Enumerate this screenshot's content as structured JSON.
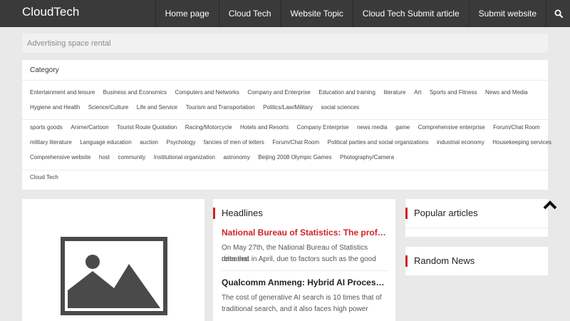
{
  "header": {
    "brand": "CloudTech",
    "nav": [
      "Home page",
      "Cloud Tech",
      "Website Topic",
      "Cloud Tech Submit article",
      "Submit website"
    ],
    "search_icon": "search-icon"
  },
  "ad": {
    "text": "Advertising space rental"
  },
  "category": {
    "title": "Category",
    "groups": [
      [
        "Entertainment and leisure",
        "Business and Economics",
        "Computers and Networks",
        "Company and Enterprise",
        "Education and training",
        "literature",
        "Art",
        "Sports and Fitness",
        "News and Media"
      ],
      [
        "Hygiene and Health",
        "Science/Culture",
        "Life and Service",
        "Tourism and Transportation",
        "Politics/Law/Military",
        "social sciences"
      ],
      [
        "sports goods",
        "Anime/Cartoon",
        "Tourist Route Quotation",
        "Racing/Motorcycle",
        "Hotels and Resorts",
        "Company Enterprise",
        "news media",
        "game",
        "Comprehensive enterprise",
        "Forum/Chat Room"
      ],
      [
        "military literature",
        "Language education",
        "auction",
        "Psychology",
        "fancies of men of letters",
        "Forum/Chat Room",
        "Political parties and social organizations",
        "industrial economy",
        "Housekeeping services"
      ],
      [
        "Comprehensive website",
        "host",
        "community",
        "Institutional organization",
        "astronomy",
        "Beijing 2008 Olympic Games",
        "Photography/Camera"
      ],
      [
        "Cloud Tech"
      ]
    ]
  },
  "headlines": {
    "title": "Headlines",
    "items": [
      {
        "title": "National Bureau of Statistics: The profit of industrial enterprises above designated size",
        "excerpt_line1": "On May 27th, the National Bureau of Statistics released",
        "excerpt_line2": "data that in April, due to factors such as the good"
      },
      {
        "title": "Qualcomm Anmeng: Hybrid AI Processing is the future",
        "excerpt_line1": "The cost of generative AI search is 10 times that of",
        "excerpt_line2": "traditional search, and it also faces high power"
      }
    ]
  },
  "sidebar": {
    "popular_title": "Popular articles",
    "random_title": "Random News"
  },
  "icons": {
    "image_placeholder": "image-placeholder-icon",
    "back_to_top": "chevron-up-icon"
  },
  "colors": {
    "topbar": "#3a3a3a",
    "accent": "#d0222a",
    "background": "#e9e9e9"
  }
}
